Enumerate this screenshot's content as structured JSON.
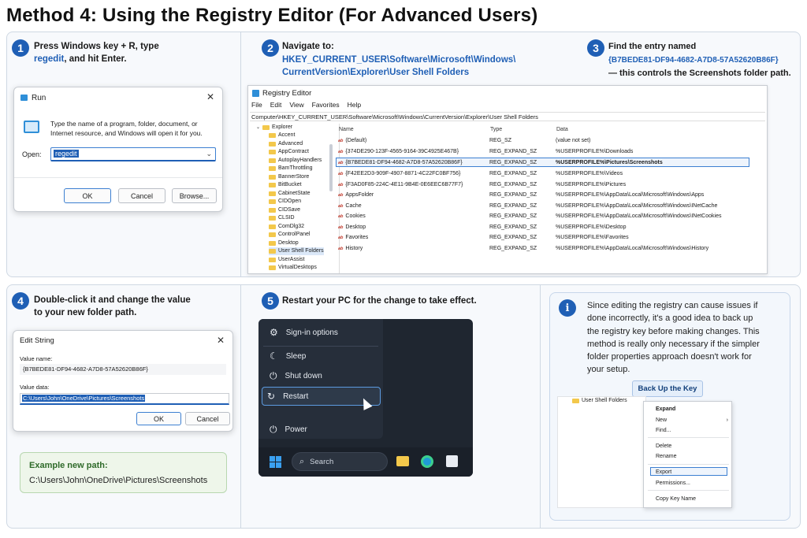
{
  "title": "Method 4: Using the Registry Editor (For Advanced Users)",
  "steps": {
    "s1": {
      "num": "1",
      "line1": "Press Windows key + R, type",
      "highlight": "regedit",
      "rest": ", and hit Enter."
    },
    "s2": {
      "num": "2",
      "line1": "Navigate to:",
      "path1": "HKEY_CURRENT_USER\\Software\\Microsoft\\Windows\\",
      "path2": "CurrentVersion\\Explorer\\User Shell Folders"
    },
    "s3": {
      "num": "3",
      "line1": "Find the entry named",
      "guid": "{B7BEDE81-DF94-4682-A7D8-57A52620B86F}",
      "line3": "— this controls the Screenshots folder path."
    },
    "s4": {
      "num": "4",
      "line1": "Double-click it and change the value",
      "line2": "to your new folder path."
    },
    "s5": {
      "num": "5",
      "line1": "Restart your PC for the change to take effect."
    }
  },
  "run": {
    "title": "Run",
    "desc": "Type the name of a program, folder, document, or Internet resource, and Windows will open it for you.",
    "open_label": "Open:",
    "value": "regedit",
    "ok": "OK",
    "cancel": "Cancel",
    "browse": "Browse..."
  },
  "regedit": {
    "title": "Registry Editor",
    "menu": [
      "File",
      "Edit",
      "View",
      "Favorites",
      "Help"
    ],
    "address": "Computer\\HKEY_CURRENT_USER\\Software\\Microsoft\\Windows\\CurrentVersion\\Explorer\\User Shell Folders",
    "tree_root": "Explorer",
    "tree": [
      "Accent",
      "Advanced",
      "AppContract",
      "AutoplayHandlers",
      "BamThrottling",
      "BannerStore",
      "BitBucket",
      "CabinetState",
      "CIDOpen",
      "CIDSave",
      "CLSID",
      "ComDlg32",
      "ControlPanel",
      "Desktop",
      "User Shell Folders",
      "UserAssist",
      "VirtualDesktops"
    ],
    "columns": {
      "name": "Name",
      "type": "Type",
      "data": "Data"
    },
    "rows": [
      {
        "name": "(Default)",
        "type": "REG_SZ",
        "data": "(value not set)"
      },
      {
        "name": "{374DE290-123F-4565-9164-39C4925E467B}",
        "type": "REG_EXPAND_SZ",
        "data": "%USERPROFILE%\\Downloads"
      },
      {
        "name": "{B7BEDE81-DF94-4682-A7D8-57A52620B86F}",
        "type": "REG_EXPAND_SZ",
        "data": "%USERPROFILE%\\Pictures\\Screenshots"
      },
      {
        "name": "{F42EE2D3-909F-4907-8871-4C22FC0BF756}",
        "type": "REG_EXPAND_SZ",
        "data": "%USERPROFILE%\\Videos"
      },
      {
        "name": "{F3AD0F85-224C-4E11-9B4E-0E6EEC6B77F7}",
        "type": "REG_EXPAND_SZ",
        "data": "%USERPROFILE%\\Pictures"
      },
      {
        "name": "AppsFolder",
        "type": "REG_EXPAND_SZ",
        "data": "%USERPROFILE%\\AppData\\Local\\Microsoft\\Windows\\Apps"
      },
      {
        "name": "Cache",
        "type": "REG_EXPAND_SZ",
        "data": "%USERPROFILE%\\AppData\\Local\\Microsoft\\Windows\\INetCache"
      },
      {
        "name": "Cookies",
        "type": "REG_EXPAND_SZ",
        "data": "%USERPROFILE%\\AppData\\Local\\Microsoft\\Windows\\INetCookies"
      },
      {
        "name": "Desktop",
        "type": "REG_EXPAND_SZ",
        "data": "%USERPROFILE%\\Desktop"
      },
      {
        "name": "Favorites",
        "type": "REG_EXPAND_SZ",
        "data": "%USERPROFILE%\\Favorites"
      },
      {
        "name": "History",
        "type": "REG_EXPAND_SZ",
        "data": "%USERPROFILE%\\AppData\\Local\\Microsoft\\Windows\\History"
      }
    ]
  },
  "edit_string": {
    "title": "Edit String",
    "name_label": "Value name:",
    "name_value": "{B7BEDE81-DF94-4682-A7D8-57A52620B86F}",
    "data_label": "Value data:",
    "data_value": "C:\\Users\\John\\OneDrive\\Pictures\\Screenshots",
    "ok": "OK",
    "cancel": "Cancel"
  },
  "example": {
    "label": "Example new path:",
    "path": "C:\\Users\\John\\OneDrive\\Pictures\\Screenshots"
  },
  "start_menu": {
    "items": [
      "Sign-in options",
      "Sleep",
      "Shut down",
      "Restart"
    ],
    "power": "Power",
    "search": "Search"
  },
  "tip": {
    "icon": "i",
    "text": "Since editing the registry can cause issues if done incorrectly, it's a good idea to back up the registry key before making changes. This method is really only necessary if the simpler folder properties approach doesn't work for your setup.",
    "button": "Back Up the Key",
    "folder": "User Shell Folders",
    "menu": [
      "Expand",
      "New",
      "Find...",
      "Delete",
      "Rename",
      "Export",
      "Permissions...",
      "Copy Key Name"
    ]
  },
  "colors": {
    "accent": "#1f5fb5",
    "panel_bg": "#f7f9fc",
    "start_bg": "#1f2630"
  }
}
